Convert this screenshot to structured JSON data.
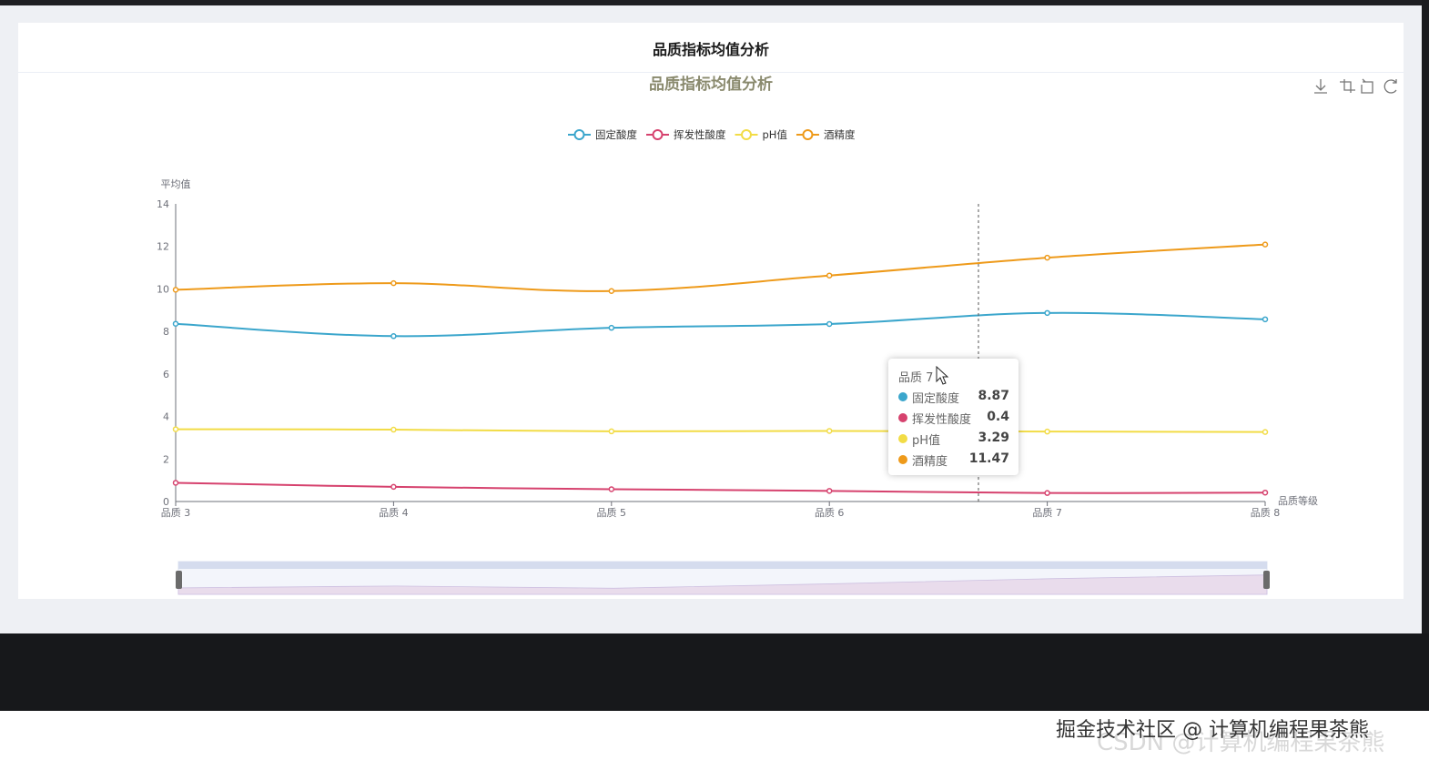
{
  "card": {
    "title": "品质指标均值分析"
  },
  "toolbox": [
    "download-icon",
    "zoom-icon",
    "zoom-reset-icon",
    "restore-icon"
  ],
  "chart_data": {
    "type": "line",
    "title": "品质指标均值分析",
    "xlabel": "品质等级",
    "ylabel": "平均值",
    "categories": [
      "品质 3",
      "品质 4",
      "品质 5",
      "品质 6",
      "品质 7",
      "品质 8"
    ],
    "ylim": [
      0,
      14
    ],
    "yticks": [
      0,
      2,
      4,
      6,
      8,
      10,
      12,
      14
    ],
    "smooth": true,
    "legend_position": "top-center",
    "series": [
      {
        "name": "固定酸度",
        "color": "#3ba6cc",
        "values": [
          8.36,
          7.78,
          8.17,
          8.35,
          8.87,
          8.57
        ]
      },
      {
        "name": "挥发性酸度",
        "color": "#d6426e",
        "values": [
          0.88,
          0.69,
          0.58,
          0.5,
          0.4,
          0.42
        ]
      },
      {
        "name": "pH值",
        "color": "#f2dc46",
        "values": [
          3.4,
          3.38,
          3.3,
          3.32,
          3.29,
          3.27
        ]
      },
      {
        "name": "酒精度",
        "color": "#ee9a1a",
        "values": [
          9.96,
          10.27,
          9.9,
          10.63,
          11.47,
          12.09
        ]
      }
    ],
    "tooltip": {
      "category": "品质 7",
      "items": [
        {
          "name": "固定酸度",
          "value": "8.87",
          "color": "#3ba6cc"
        },
        {
          "name": "挥发性酸度",
          "value": "0.4",
          "color": "#d6426e"
        },
        {
          "name": "pH值",
          "value": "3.29",
          "color": "#f2dc46"
        },
        {
          "name": "酒精度",
          "value": "11.47",
          "color": "#ee9a1a"
        }
      ]
    }
  },
  "watermark": {
    "primary": "掘金技术社区 @ 计算机编程果茶熊",
    "secondary": "CSDN @计算机编程果茶熊"
  }
}
